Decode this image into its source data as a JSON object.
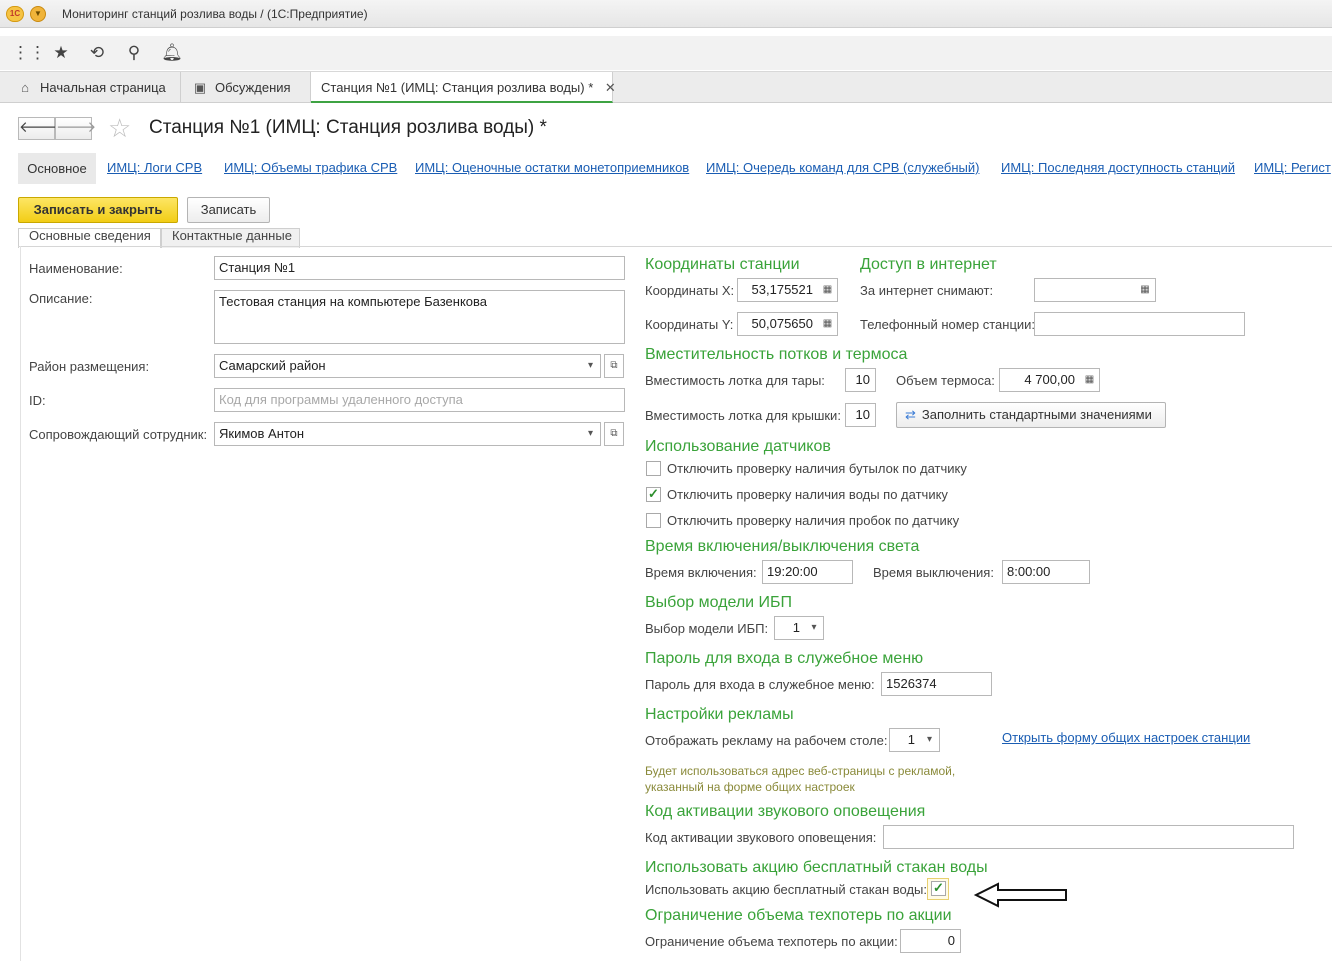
{
  "window": {
    "title": "Мониторинг станций розлива воды /  (1С:Предприятие)",
    "logo_text": "1С"
  },
  "toolbar": {
    "icons": [
      "apps-grid-icon",
      "star-icon",
      "history-icon",
      "search-icon",
      "bell-icon"
    ]
  },
  "tabs": [
    {
      "label": "Начальная страница",
      "icon": "home-icon"
    },
    {
      "label": "Обсуждения",
      "icon": "chat-icon"
    },
    {
      "label": "Станция №1 (ИМЦ: Станция розлива воды) *",
      "active": true
    }
  ],
  "form": {
    "title": "Станция №1 (ИМЦ: Станция розлива воды) *",
    "panel": {
      "main": "Основное",
      "links": [
        "ИМЦ: Логи СРВ",
        "ИМЦ: Объемы трафика СРВ",
        "ИМЦ: Оценочные остатки монетоприемников",
        "ИМЦ: Очередь команд для СРВ (служебный)",
        "ИМЦ: Последняя доступность станций",
        "ИМЦ: Регист"
      ]
    },
    "buttons": {
      "save_close": "Записать и закрыть",
      "save": "Записать"
    },
    "inner_tabs": [
      "Основные сведения",
      "Контактные данные"
    ]
  },
  "left": {
    "name_label": "Наименование:",
    "name_value": "Станция №1",
    "desc_label": "Описание:",
    "desc_value": "Тестовая станция на компьютере Базенкова",
    "district_label": "Район размещения:",
    "district_value": "Самарский район",
    "id_label": "ID:",
    "id_placeholder": "Код для программы удаленного доступа",
    "employee_label": "Сопровождающий сотрудник:",
    "employee_value": "Якимов Антон"
  },
  "right": {
    "coords": {
      "title": "Координаты станции",
      "x_label": "Координаты X:",
      "x_value": "53,175521",
      "y_label": "Координаты Y:",
      "y_value": "50,075650"
    },
    "internet": {
      "title": "Доступ в интернет",
      "charge_label": "За интернет снимают:",
      "charge_value": "",
      "phone_label": "Телефонный номер станции:",
      "phone_value": ""
    },
    "capacity": {
      "title": "Вместительность потков и термоса",
      "tray_label": "Вместимость лотка для тары:",
      "tray_value": "10",
      "thermos_label": "Объем термоса:",
      "thermos_value": "4 700,00",
      "lid_label": "Вместимость лотка для крышки:",
      "lid_value": "10",
      "fill_button": "Заполнить стандартными значениями"
    },
    "sensors": {
      "title": "Использование датчиков",
      "items": [
        {
          "label": "Отключить проверку наличия бутылок по датчику",
          "checked": false
        },
        {
          "label": "Отключить проверку наличия воды по датчику",
          "checked": true
        },
        {
          "label": "Отключить проверку наличия пробок по датчику",
          "checked": false
        }
      ]
    },
    "light": {
      "title": "Время включения/выключения света",
      "on_label": "Время включения:",
      "on_value": "19:20:00",
      "off_label": "Время выключения:",
      "off_value": "8:00:00"
    },
    "ups": {
      "title": "Выбор модели ИБП",
      "label": "Выбор модели ИБП:",
      "value": "1"
    },
    "password": {
      "title": "Пароль для входа в служебное меню",
      "label": "Пароль для входа в служебное меню:",
      "value": "1526374"
    },
    "ads": {
      "title": "Настройки рекламы",
      "label": "Отображать рекламу на рабочем столе:",
      "value": "1",
      "link": "Открыть форму общих настроек станции",
      "hint1": "Будет использоваться адрес веб-страницы с рекламой,",
      "hint2": "указанный на форме общих настроек"
    },
    "sound": {
      "title": "Код активации звукового оповещения",
      "label": "Код активации звукового оповещения:",
      "value": ""
    },
    "promo": {
      "title": "Использовать акцию бесплатный стакан воды",
      "label": "Использовать акцию бесплатный стакан воды:",
      "checked": true
    },
    "limit": {
      "title": "Ограничение объема техпотерь по акции",
      "label": "Ограничение объема техпотерь по акции:",
      "value": "0"
    }
  }
}
